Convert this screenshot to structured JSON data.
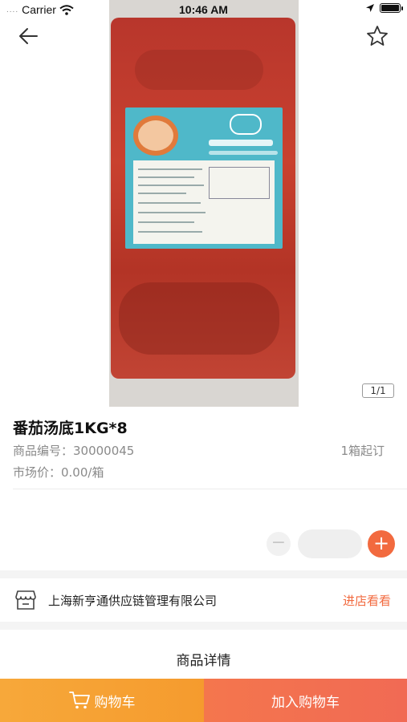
{
  "status_bar": {
    "carrier": "Carrier",
    "time": "10:46 AM",
    "signal_dots": "....",
    "wifi_icon": "wifi-icon",
    "location_icon": "location-arrow-icon",
    "battery_icon": "battery-icon"
  },
  "header": {
    "back_icon": "back-arrow-icon",
    "favorite_icon": "star-outline-icon"
  },
  "gallery": {
    "pager": "1/1"
  },
  "product": {
    "title": "番茄汤底1KG*8",
    "code": "商品编号：30000045",
    "min_order": "1箱起订",
    "price": "市场价：0.00/箱"
  },
  "quantity": {
    "minus_label": "−",
    "value": "",
    "plus_label": "+"
  },
  "store": {
    "icon": "store-icon",
    "name": "上海新亨通供应链管理有限公司",
    "link": "进店看看"
  },
  "detail": {
    "title": "商品详情"
  },
  "bottom_bar": {
    "cart_icon": "cart-icon",
    "cart_label": "购物车",
    "add_label": "加入购物车"
  },
  "colors": {
    "accent": "#f26a3f",
    "cart_button": "#f5a035",
    "add_button": "#f2704f"
  }
}
